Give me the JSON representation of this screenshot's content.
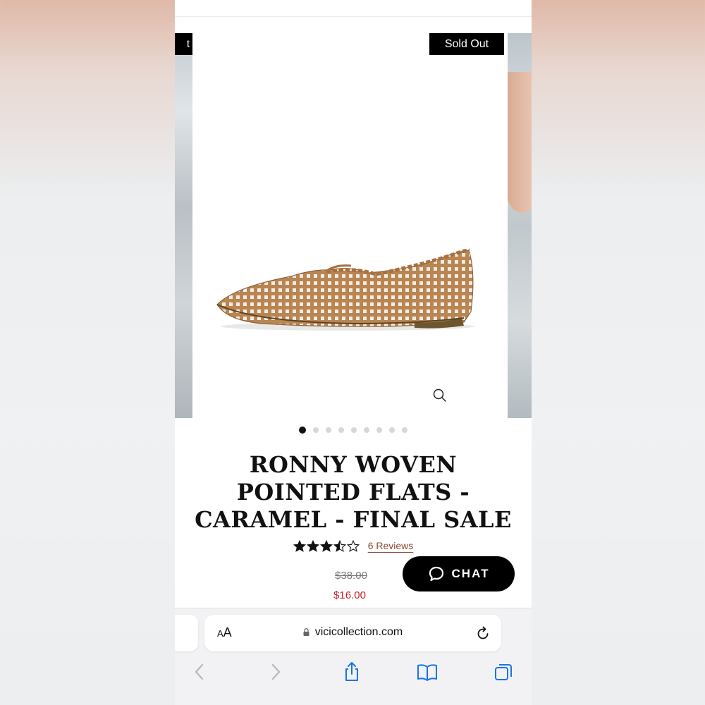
{
  "product": {
    "badge": "Sold Out",
    "title": "RONNY WOVEN POINTED FLATS - CARAMEL - FINAL SALE",
    "rating": 3.5,
    "rating_max": 5,
    "reviews_label": "6 Reviews",
    "price_original": "$38.00",
    "price_sale": "$16.00",
    "image_icon": "woven-flat-shoe"
  },
  "carousel": {
    "slide_count": 9,
    "active_index": 0
  },
  "chat": {
    "label": "CHAT",
    "icon": "chat-bubble-icon"
  },
  "browser": {
    "text_size_label": "AA",
    "url": "vicicollection.com",
    "icons": [
      "back-icon",
      "forward-icon",
      "share-icon",
      "bookmarks-icon",
      "tabs-icon",
      "reload-icon",
      "lock-icon"
    ]
  },
  "colors": {
    "badge_bg": "#000000",
    "sale_price": "#c0232b",
    "reviews_link": "#8a4b36",
    "browser_accent": "#1a73e8"
  }
}
